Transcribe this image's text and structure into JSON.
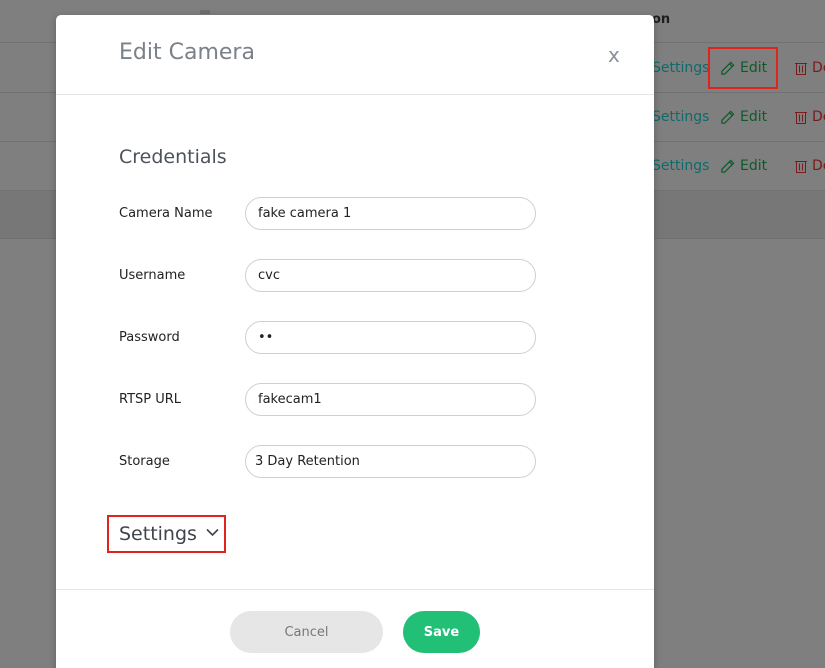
{
  "background": {
    "header_text": "on",
    "rows": [
      {
        "settings_label": "Settings",
        "edit_label": "Edit",
        "delete_label": "De"
      },
      {
        "settings_label": "Settings",
        "edit_label": "Edit",
        "delete_label": "De"
      },
      {
        "settings_label": "Settings",
        "edit_label": "Edit",
        "delete_label": "De"
      }
    ]
  },
  "modal": {
    "title": "Edit Camera",
    "close_label": "x",
    "section_title": "Credentials",
    "fields": [
      {
        "label": "Camera Name",
        "value": "fake camera 1"
      },
      {
        "label": "Username",
        "value": "cvc"
      },
      {
        "label": "Password",
        "value": "••"
      },
      {
        "label": "RTSP URL",
        "value": "fakecam1"
      },
      {
        "label": "Storage",
        "value": "3 Day Retention"
      }
    ],
    "settings_toggle_label": "Settings",
    "cancel_label": "Cancel",
    "save_label": "Save"
  },
  "colors": {
    "accent_green": "#22c077",
    "highlight_red": "#e0241d",
    "overlay_gray": "#7f7f7f"
  },
  "icons": {
    "edit": "pencil-icon",
    "delete": "trash-icon",
    "settings_toggle": "chevron-down-icon"
  }
}
